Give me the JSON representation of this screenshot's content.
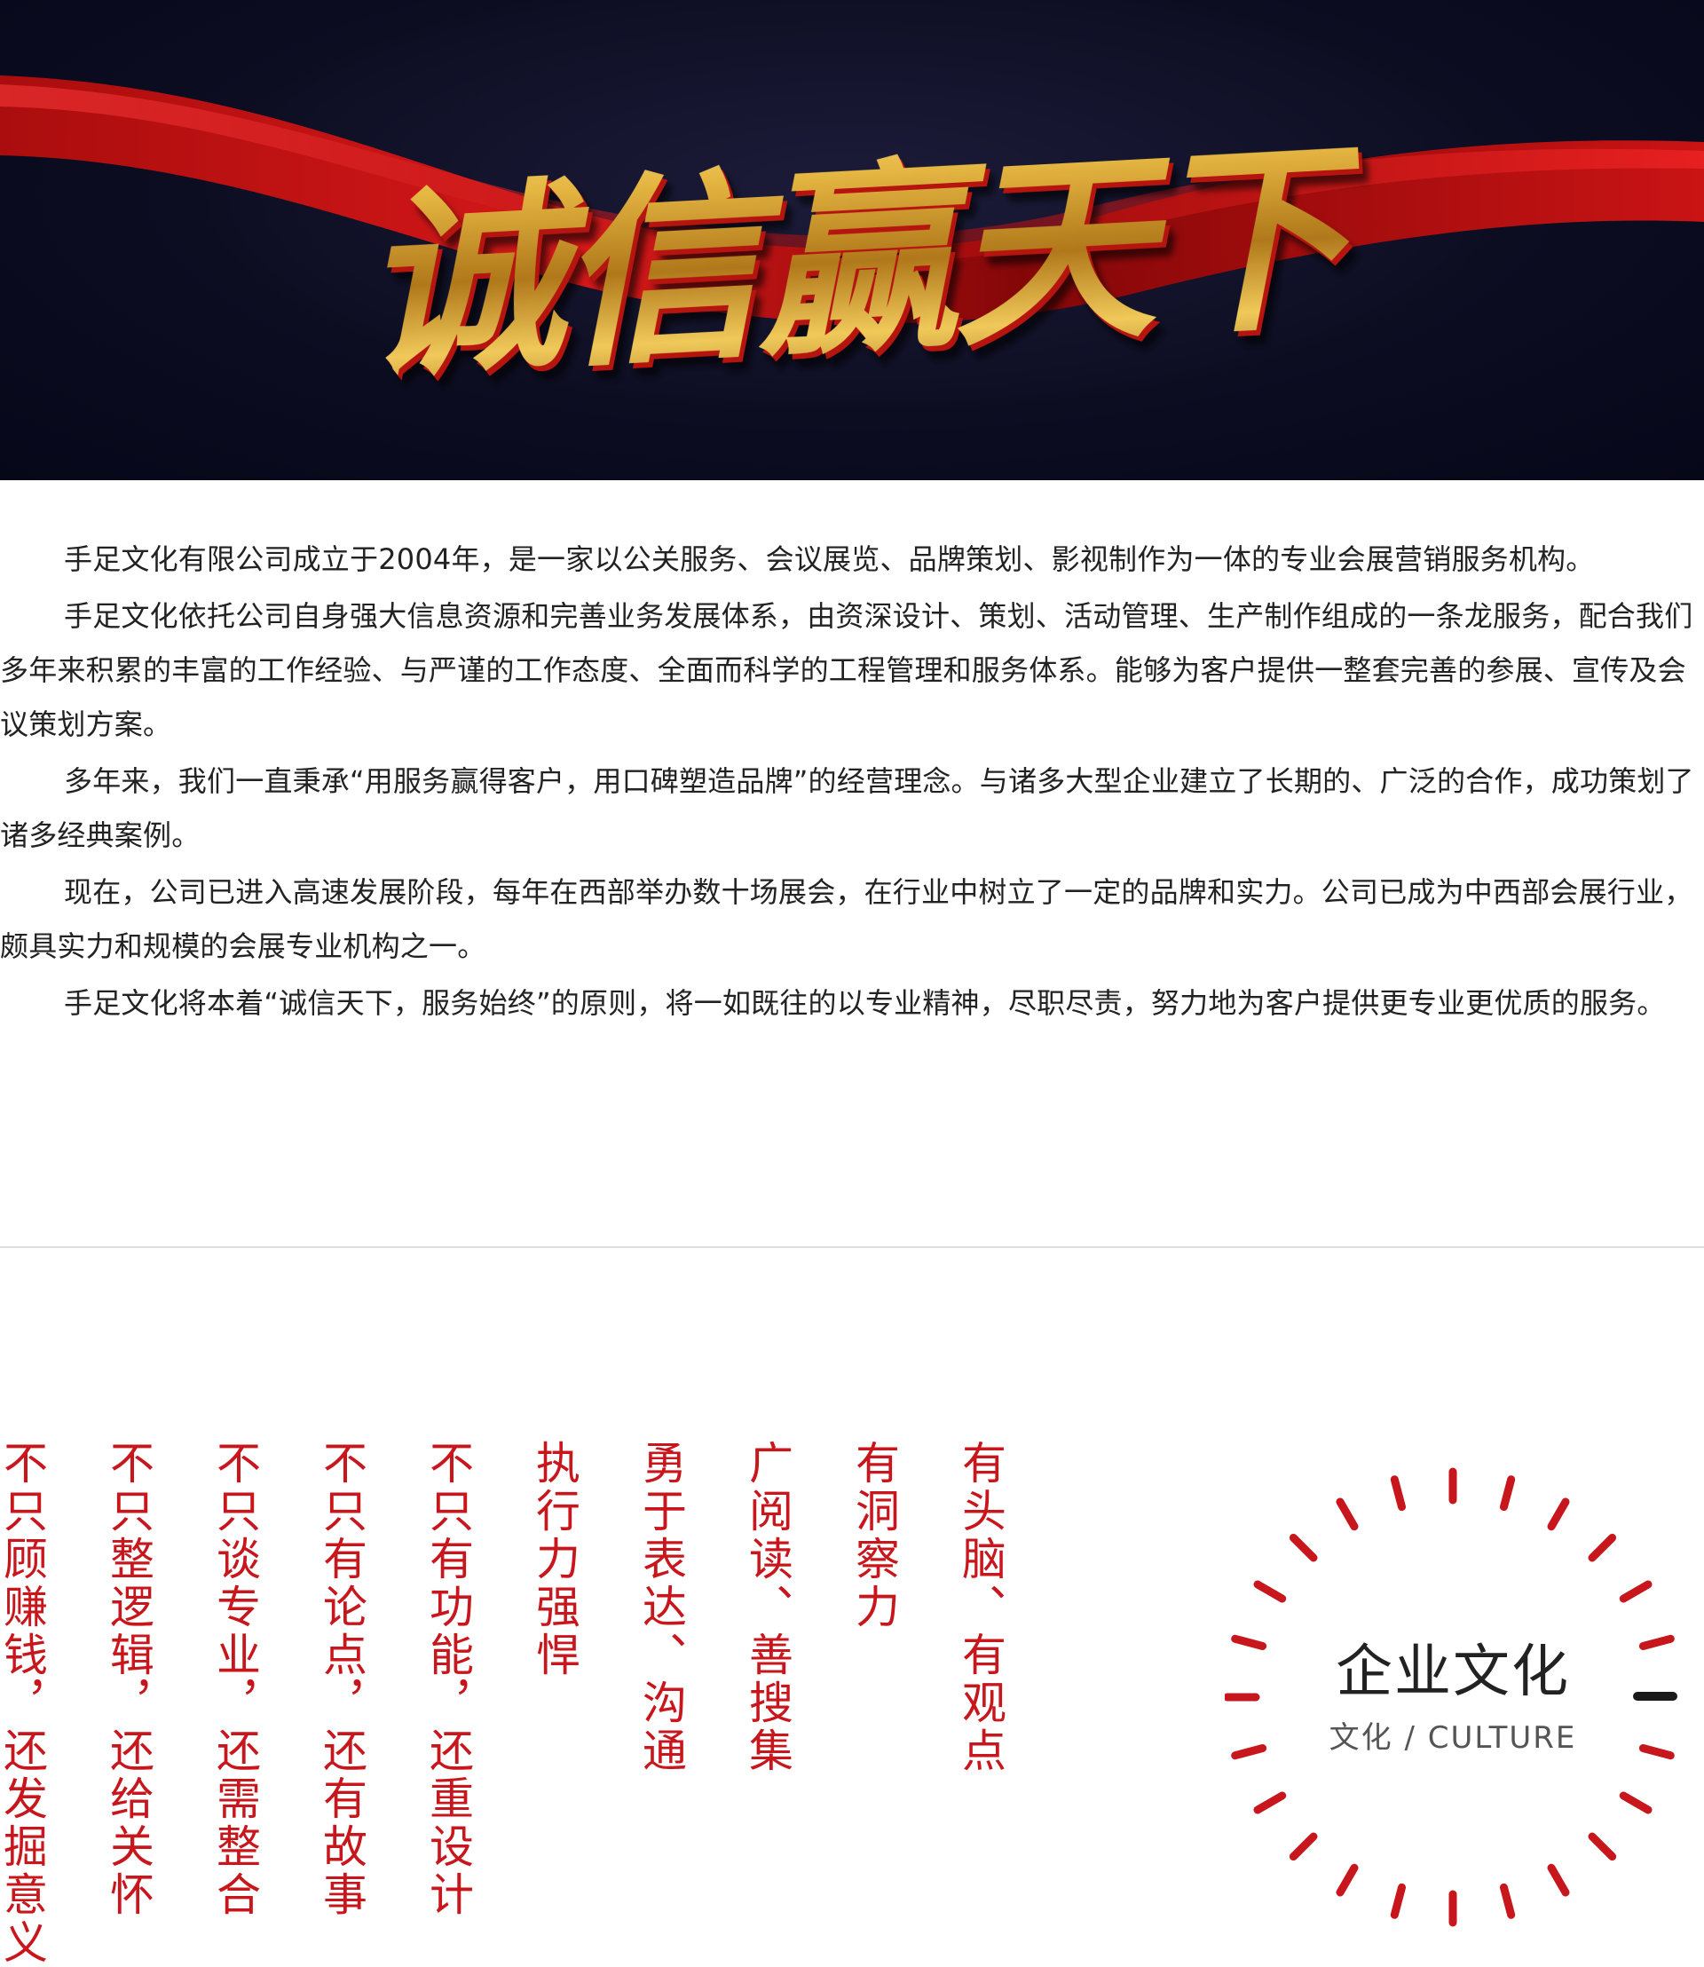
{
  "banner": {
    "title": "诚信赢天下"
  },
  "intro": {
    "paragraphs": [
      "手足文化有限公司成立于2004年，是一家以公关服务、会议展览、品牌策划、影视制作为一体的专业会展营销服务机构。",
      "手足文化依托公司自身强大信息资源和完善业务发展体系，由资深设计、策划、活动管理、生产制作组成的一条龙服务，配合我们多年来积累的丰富的工作经验、与严谨的工作态度、全面而科学的工程管理和服务体系。能够为客户提供一整套完善的参展、宣传及会议策划方案。",
      "多年来，我们一直秉承“用服务赢得客户，用口碑塑造品牌”的经营理念。与诸多大型企业建立了长期的、广泛的合作，成功策划了诸多经典案例。",
      "现在，公司已进入高速发展阶段，每年在西部举办数十场展会，在行业中树立了一定的品牌和实力。公司已成为中西部会展行业，颇具实力和规模的会展专业机构之一。",
      "手足文化将本着“诚信天下，服务始终”的原则，将一如既往的以专业精神，尽职尽责，努力地为客户提供更专业更优质的服务。"
    ]
  },
  "culture": {
    "lines": [
      "不只顾赚钱，还发掘意义",
      "不只整逻辑，还给关怀",
      "不只谈专业，还需整合",
      "不只有论点，还有故事",
      "不只有功能，还重设计",
      "执行力强悍",
      "勇于表达、沟通",
      "广阅读、善搜集",
      "有洞察力",
      "有头脑、有观点"
    ],
    "emblem_title": "企业文化",
    "emblem_subtitle": "文化 / CULTURE",
    "accent_color": "#c8161d"
  }
}
